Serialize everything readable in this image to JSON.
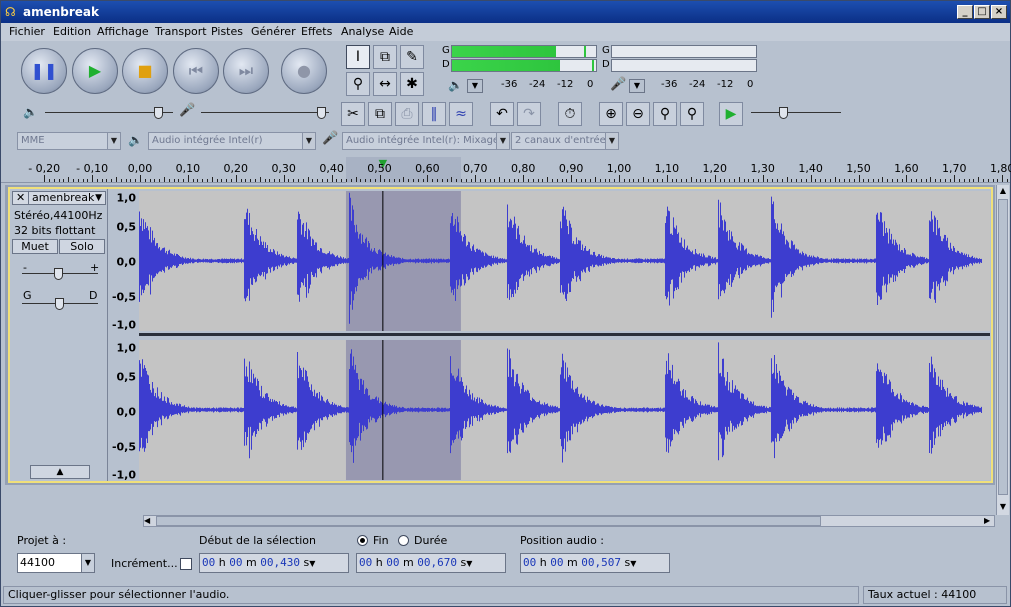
{
  "window": {
    "title": "amenbreak"
  },
  "menu": [
    "Fichier",
    "Edition",
    "Affichage",
    "Transport",
    "Pistes",
    "Générer",
    "Effets",
    "Analyse",
    "Aide"
  ],
  "meters": {
    "play_left_label": "G",
    "play_right_label": "D",
    "rec_left_label": "G",
    "rec_right_label": "D",
    "scale": [
      "-36",
      "-24",
      "-12",
      "0"
    ],
    "play_left_level": 0.72,
    "play_right_level": 0.75,
    "play_left_peak": 0.92,
    "play_right_peak": 0.97
  },
  "mixer": {
    "playback_volume": 0.92,
    "record_volume": 0.98,
    "speed": 0.35
  },
  "devices": {
    "host": "MME",
    "output": "Audio intégrée Intel(r)",
    "input": "Audio intégrée Intel(r): Mixage",
    "channels": "2 canaux d'entrée"
  },
  "ruler": {
    "labels": [
      "- 0,20",
      "- 0,10",
      "0,00",
      "0,10",
      "0,20",
      "0,30",
      "0,40",
      "0,50",
      "0,60",
      "0,70",
      "0,80",
      "0,90",
      "1,00",
      "1,10",
      "1,20",
      "1,30",
      "1,40",
      "1,50",
      "1,60",
      "1,70",
      "1,80"
    ],
    "highlight_label": "0,50",
    "play_position": 0.507,
    "selection_start": 0.43,
    "selection_end": 0.67
  },
  "track": {
    "name": "amenbreak",
    "info1": "Stéréo,44100Hz",
    "info2": "32 bits flottant",
    "mute": "Muet",
    "solo": "Solo",
    "gain_minus": "-",
    "gain_plus": "+",
    "pan_left": "G",
    "pan_right": "D",
    "scale": [
      "1,0",
      "0,5",
      "0,0",
      "-0,5",
      "-1,0"
    ]
  },
  "bottom": {
    "project_rate_label": "Projet à :",
    "project_rate": "44100",
    "snap_label": "Incrément...",
    "sel_start_label": "Début de la sélection",
    "end_label": "Fin",
    "duration_label": "Durée",
    "audio_pos_label": "Position audio :",
    "sel_start": {
      "h": "00",
      "m": "00",
      "s": "00,430"
    },
    "sel_end": {
      "h": "00",
      "m": "00",
      "s": "00,670"
    },
    "audio_pos": {
      "h": "00",
      "m": "00",
      "s": "00,507"
    },
    "unit_h": "h",
    "unit_m": "m",
    "unit_s": "s"
  },
  "status": {
    "message": "Cliquer-glisser pour sélectionner l'audio.",
    "rate": "Taux actuel : 44100"
  },
  "colors": {
    "wave": "#3d3dcf",
    "selection": "#9898b0",
    "meter": "#2ec53e"
  }
}
